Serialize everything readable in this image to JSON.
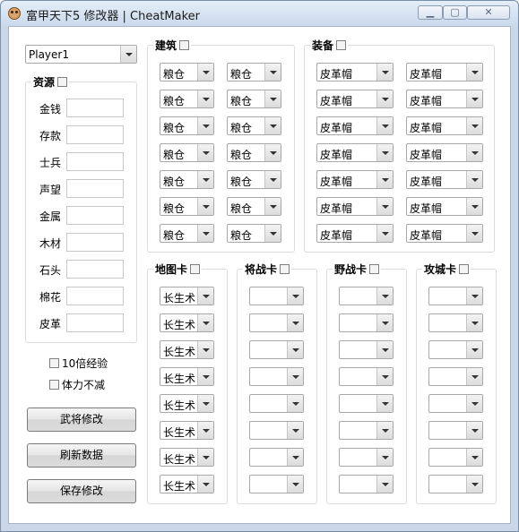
{
  "window": {
    "title": "富甲天下5 修改器 | CheatMaker"
  },
  "player_select": {
    "value": "Player1"
  },
  "resources": {
    "title": "资源",
    "fields": [
      {
        "label": "金钱",
        "value": ""
      },
      {
        "label": "存款",
        "value": ""
      },
      {
        "label": "士兵",
        "value": ""
      },
      {
        "label": "声望",
        "value": ""
      },
      {
        "label": "金属",
        "value": ""
      },
      {
        "label": "木材",
        "value": ""
      },
      {
        "label": "石头",
        "value": ""
      },
      {
        "label": "棉花",
        "value": ""
      },
      {
        "label": "皮革",
        "value": ""
      }
    ]
  },
  "options": [
    {
      "label": "10倍经验",
      "checked": false
    },
    {
      "label": "体力不减",
      "checked": false
    }
  ],
  "buttons": {
    "general_edit": "武将修改",
    "refresh": "刷新数据",
    "save": "保存修改"
  },
  "building": {
    "title": "建筑",
    "col1": [
      "粮仓",
      "粮仓",
      "粮仓",
      "粮仓",
      "粮仓",
      "粮仓",
      "粮仓"
    ],
    "col2": [
      "粮仓",
      "粮仓",
      "粮仓",
      "粮仓",
      "粮仓",
      "粮仓",
      "粮仓"
    ]
  },
  "equipment": {
    "title": "装备",
    "col1": [
      "皮革帽",
      "皮革帽",
      "皮革帽",
      "皮革帽",
      "皮革帽",
      "皮革帽",
      "皮革帽"
    ],
    "col2": [
      "皮革帽",
      "皮革帽",
      "皮革帽",
      "皮革帽",
      "皮革帽",
      "皮革帽",
      "皮革帽"
    ]
  },
  "map_cards": {
    "title": "地图卡",
    "values": [
      "长生术",
      "长生术",
      "长生术",
      "长生术",
      "长生术",
      "长生术",
      "长生术",
      "长生术"
    ]
  },
  "general_cards": {
    "title": "将战卡",
    "values": [
      "",
      "",
      "",
      "",
      "",
      "",
      "",
      ""
    ]
  },
  "field_cards": {
    "title": "野战卡",
    "values": [
      "",
      "",
      "",
      "",
      "",
      "",
      "",
      ""
    ]
  },
  "siege_cards": {
    "title": "攻城卡",
    "values": [
      "",
      "",
      "",
      "",
      "",
      "",
      "",
      ""
    ]
  }
}
